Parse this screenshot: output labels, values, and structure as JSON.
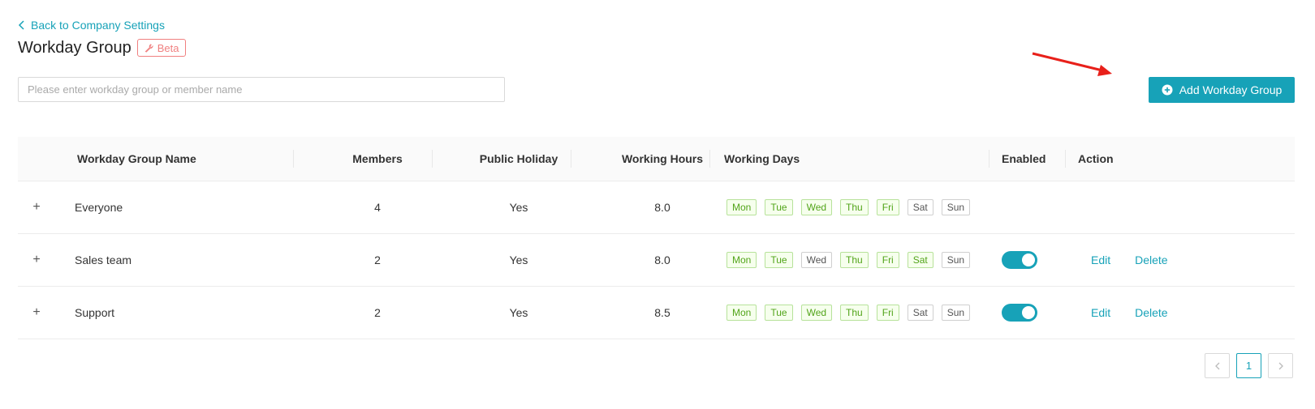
{
  "nav": {
    "back_label": "Back to Company Settings"
  },
  "header": {
    "title": "Workday Group",
    "badge": "Beta"
  },
  "search": {
    "placeholder": "Please enter workday group or member name"
  },
  "toolbar": {
    "add_label": "Add Workday Group"
  },
  "table": {
    "columns": [
      "Workday Group Name",
      "Members",
      "Public Holiday",
      "Working Hours",
      "Working Days",
      "Enabled",
      "Action"
    ],
    "rows": [
      {
        "name": "Everyone",
        "members": "4",
        "holiday": "Yes",
        "hours": "8.0",
        "days": [
          {
            "label": "Mon",
            "on": true
          },
          {
            "label": "Tue",
            "on": true
          },
          {
            "label": "Wed",
            "on": true
          },
          {
            "label": "Thu",
            "on": true
          },
          {
            "label": "Fri",
            "on": true
          },
          {
            "label": "Sat",
            "on": false
          },
          {
            "label": "Sun",
            "on": false
          }
        ],
        "enabled": null,
        "edit": "",
        "delete": ""
      },
      {
        "name": "Sales team",
        "members": "2",
        "holiday": "Yes",
        "hours": "8.0",
        "days": [
          {
            "label": "Mon",
            "on": true
          },
          {
            "label": "Tue",
            "on": true
          },
          {
            "label": "Wed",
            "on": false
          },
          {
            "label": "Thu",
            "on": true
          },
          {
            "label": "Fri",
            "on": true
          },
          {
            "label": "Sat",
            "on": true
          },
          {
            "label": "Sun",
            "on": false
          }
        ],
        "enabled": true,
        "edit": "Edit",
        "delete": "Delete"
      },
      {
        "name": "Support",
        "members": "2",
        "holiday": "Yes",
        "hours": "8.5",
        "days": [
          {
            "label": "Mon",
            "on": true
          },
          {
            "label": "Tue",
            "on": true
          },
          {
            "label": "Wed",
            "on": true
          },
          {
            "label": "Thu",
            "on": true
          },
          {
            "label": "Fri",
            "on": true
          },
          {
            "label": "Sat",
            "on": false
          },
          {
            "label": "Sun",
            "on": false
          }
        ],
        "enabled": true,
        "edit": "Edit",
        "delete": "Delete"
      }
    ]
  },
  "pagination": {
    "current": "1"
  },
  "colors": {
    "accent": "#17a2b8",
    "beta": "#f08080",
    "day_on": "#52a41a",
    "annotation_arrow": "#e8201a"
  },
  "icons": {
    "back": "chevron-left-icon",
    "beta": "wrench-icon",
    "add": "plus-circle-icon",
    "expand": "plus-icon",
    "prev": "chevron-left-icon",
    "next": "chevron-right-icon"
  }
}
